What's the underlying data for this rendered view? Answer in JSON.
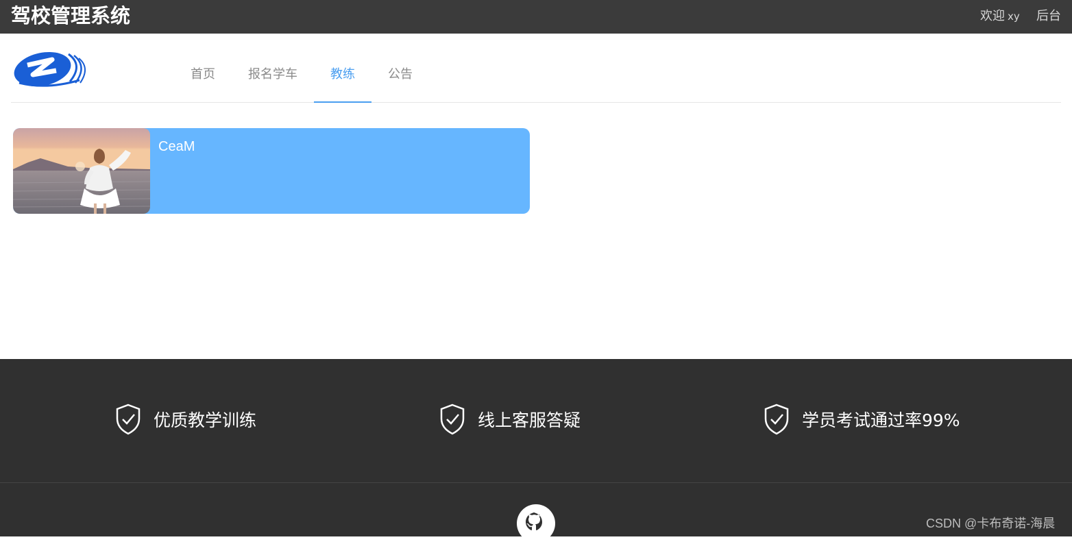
{
  "topbar": {
    "title": "驾校管理系统",
    "welcome_label": "欢迎",
    "username": "xy",
    "admin_link": "后台"
  },
  "nav": {
    "items": [
      {
        "label": "首页"
      },
      {
        "label": "报名学车"
      },
      {
        "label": "教练"
      },
      {
        "label": "公告"
      }
    ],
    "active_index": 2
  },
  "coach_card": {
    "name": "CeaM",
    "photo_icon": "coach-photo"
  },
  "footer": {
    "features": [
      {
        "icon": "shield-check-icon",
        "label": "优质教学训练"
      },
      {
        "icon": "shield-check-icon",
        "label": "线上客服答疑"
      },
      {
        "icon": "shield-check-icon",
        "label": "学员考试通过率99%"
      }
    ],
    "github_icon": "github-icon",
    "watermark": "CSDN @卡布奇诺-海晨"
  },
  "colors": {
    "topbar_bg": "#3b3b3b",
    "accent": "#4a9ef0",
    "card_bg": "#66b6ff",
    "footer_bg": "#303030"
  }
}
